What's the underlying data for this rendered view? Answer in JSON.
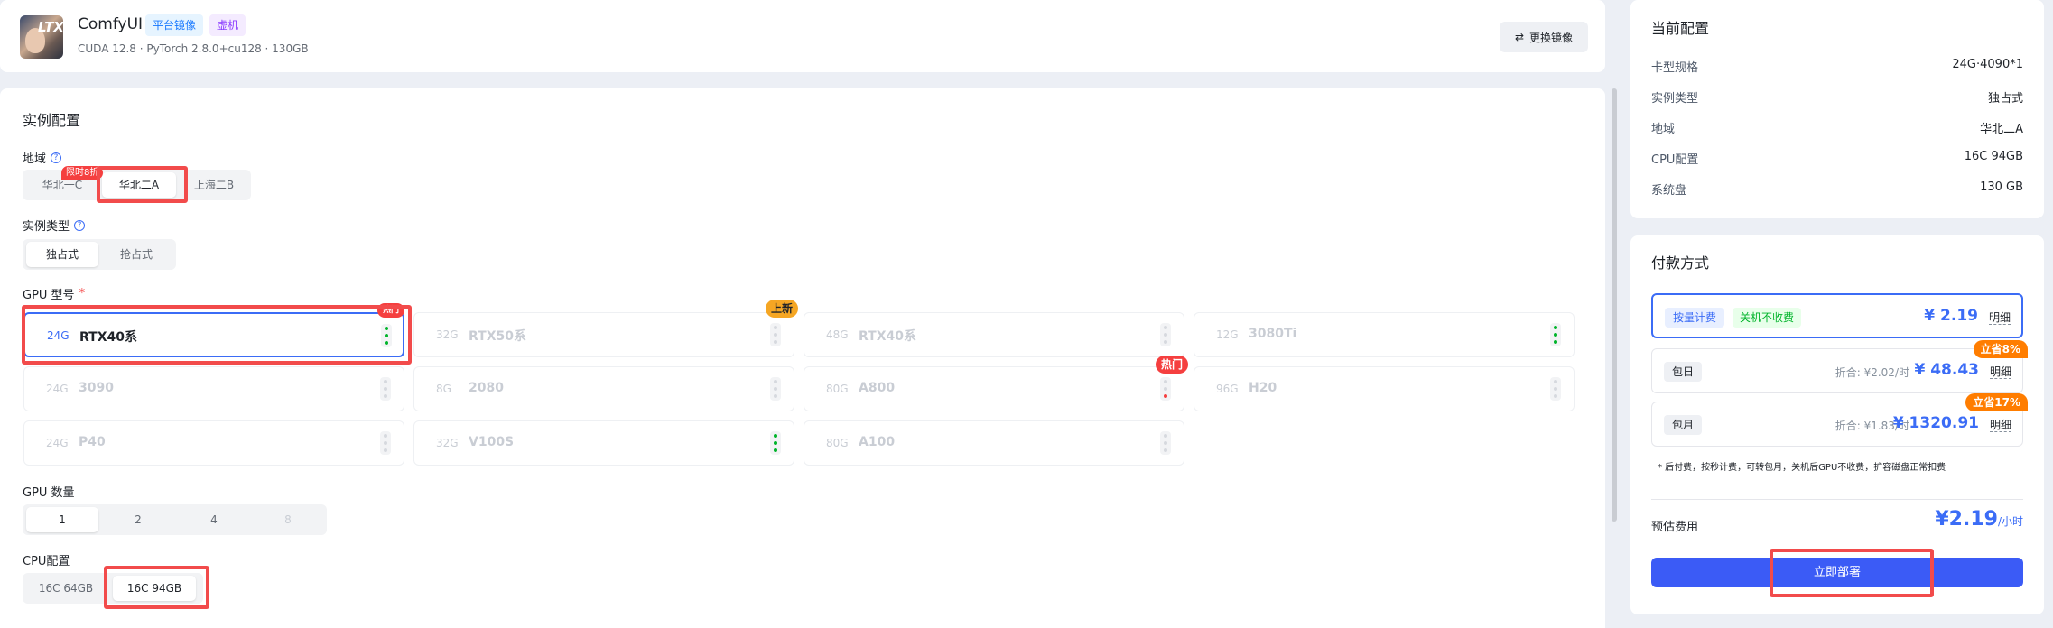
{
  "image": {
    "title": "ComfyUI",
    "tags": [
      "平台镜像",
      "虚机"
    ],
    "subtitle": "CUDA 12.8 · PyTorch 2.8.0+cu128 · 130GB",
    "switch_label": "更换镜像",
    "avatar_text": "LTX"
  },
  "config": {
    "title": "实例配置",
    "region": {
      "label": "地域",
      "options": [
        "华北一C",
        "华北二A",
        "上海二B"
      ],
      "selected": "华北二A",
      "promo_badge": "限时8折"
    },
    "instance_type": {
      "label": "实例类型",
      "options": [
        "独占式",
        "抢占式"
      ],
      "selected": "独占式"
    },
    "gpu": {
      "label": "GPU 型号",
      "required_mark": "*",
      "items": [
        {
          "mem": "24G",
          "name": "RTX40系",
          "selected": true,
          "badge": "热门",
          "availability": "high"
        },
        {
          "mem": "32G",
          "name": "RTX50系",
          "badge": "上新",
          "availability": "none"
        },
        {
          "mem": "48G",
          "name": "RTX40系",
          "availability": "none"
        },
        {
          "mem": "12G",
          "name": "3080Ti",
          "availability": "high"
        },
        {
          "mem": "24G",
          "name": "3090",
          "availability": "none"
        },
        {
          "mem": "8G",
          "name": "2080",
          "availability": "none"
        },
        {
          "mem": "80G",
          "name": "A800",
          "badge": "热门",
          "availability": "low"
        },
        {
          "mem": "96G",
          "name": "H20",
          "availability": "none"
        },
        {
          "mem": "24G",
          "name": "P40",
          "availability": "none"
        },
        {
          "mem": "32G",
          "name": "V100S",
          "availability": "high"
        },
        {
          "mem": "80G",
          "name": "A100",
          "availability": "none"
        }
      ]
    },
    "gpu_count": {
      "label": "GPU 数量",
      "options": [
        "1",
        "2",
        "4",
        "8"
      ],
      "selected": "1"
    },
    "cpu": {
      "label": "CPU配置",
      "options": [
        "16C 64GB",
        "16C 94GB"
      ],
      "selected": "16C 94GB"
    }
  },
  "current": {
    "title": "当前配置",
    "rows": [
      {
        "k": "卡型规格",
        "v": "24G·4090*1"
      },
      {
        "k": "实例类型",
        "v": "独占式"
      },
      {
        "k": "地域",
        "v": "华北二A"
      },
      {
        "k": "CPU配置",
        "v": "16C 94GB"
      },
      {
        "k": "系统盘",
        "v": "130 GB"
      }
    ]
  },
  "payment": {
    "title": "付款方式",
    "options": [
      {
        "label": "按量计费",
        "free_tag": "关机不收费",
        "price": "¥ 2.19",
        "detail": "明细"
      },
      {
        "label": "包日",
        "discount": "折合: ¥2.02/时",
        "price": "¥ 48.43",
        "detail": "明细",
        "save": "立省8%"
      },
      {
        "label": "包月",
        "discount": "折合: ¥1.83/时",
        "price": "¥ 1320.91",
        "detail": "明细",
        "save": "立省17%"
      }
    ],
    "note": "* 后付费，按秒计费，可转包月，关机后GPU不收费，扩容磁盘正常扣费",
    "estimate_label": "预估费用",
    "estimate_value": "¥2.19",
    "estimate_unit": "/小时",
    "deploy_label": "立即部署"
  },
  "colors": {
    "accent": "#3b5bf6",
    "highlight_box": "#f24b4b",
    "available": "#00b42a"
  }
}
